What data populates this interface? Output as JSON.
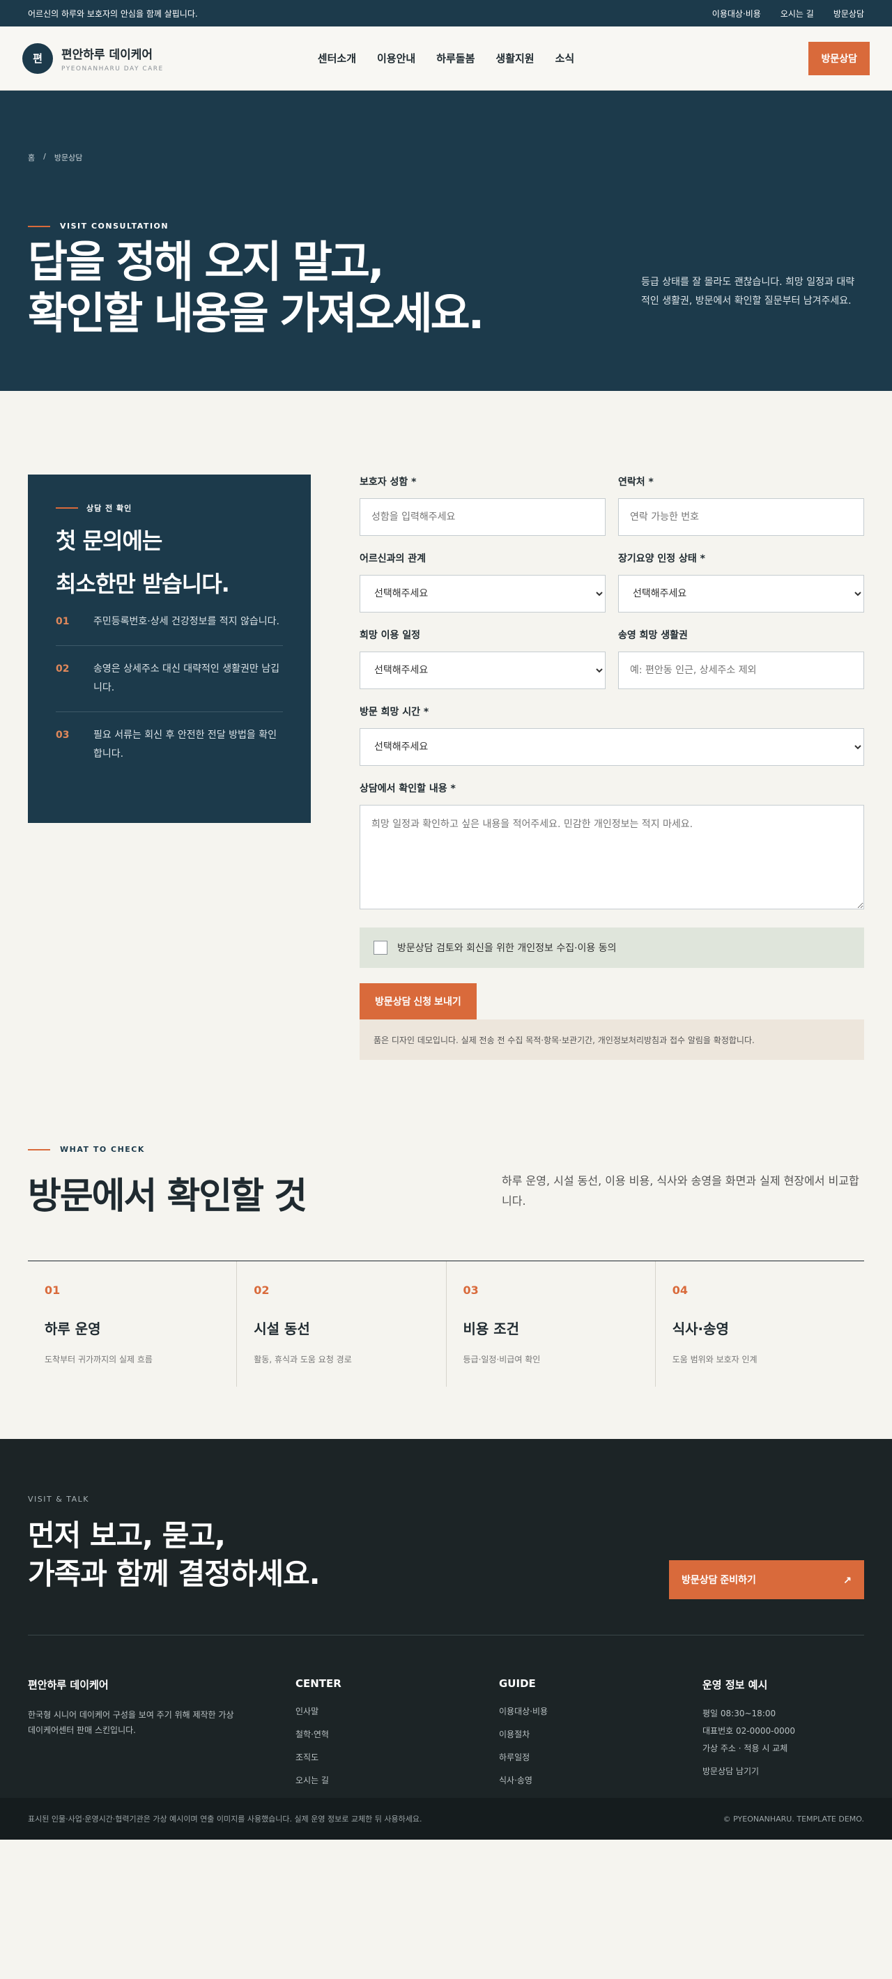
{
  "topbar": {
    "message": "어르신의 하루와 보호자의 안심을 함께 살핍니다.",
    "links": [
      "이용대상·비용",
      "오시는 길",
      "방문상담"
    ]
  },
  "header": {
    "logo_mark": "편",
    "name": "편안하루 데이케어",
    "sub": "PYEONANHARU DAY CARE",
    "nav": [
      "센터소개",
      "이용안내",
      "하루돌봄",
      "생활지원",
      "소식"
    ],
    "cta": "방문상담"
  },
  "hero": {
    "breadcrumb_home": "홈",
    "breadcrumb_sep": "/",
    "breadcrumb_current": "방문상담",
    "eyebrow": "VISIT CONSULTATION",
    "title_line1": "답을 정해 오지 말고,",
    "title_line2": "확인할 내용을 가져오세요.",
    "desc": "등급 상태를 잘 몰라도 괜찮습니다. 희망 일정과 대략적인 생활권, 방문에서 확인할 질문부터 남겨주세요."
  },
  "side": {
    "eyebrow": "상담 전 확인",
    "title_line1": "첫 문의에는",
    "title_line2": "최소한만 받습니다.",
    "items": [
      {
        "num": "01",
        "text": "주민등록번호·상세 건강정보를 적지 않습니다."
      },
      {
        "num": "02",
        "text": "송영은 상세주소 대신 대략적인 생활권만 남깁니다."
      },
      {
        "num": "03",
        "text": "필요 서류는 회신 후 안전한 전달 방법을 확인합니다."
      }
    ]
  },
  "form": {
    "guardian_label": "보호자 성함 *",
    "guardian_ph": "성함을 입력해주세요",
    "phone_label": "연락처 *",
    "phone_ph": "연락 가능한 번호",
    "relation_label": "어르신과의 관계",
    "relation_value": "선택해주세요",
    "grade_label": "장기요양 인정 상태 *",
    "grade_value": "선택해주세요",
    "schedule_label": "희망 이용 일정",
    "schedule_value": "선택해주세요",
    "area_label": "송영 희망 생활권",
    "area_ph": "예: 편안동 인근, 상세주소 제외",
    "time_label": "방문 희망 시간 *",
    "time_value": "선택해주세요",
    "content_label": "상담에서 확인할 내용 *",
    "content_ph": "희망 일정과 확인하고 싶은 내용을 적어주세요. 민감한 개인정보는 적지 마세요.",
    "consent": "방문상담 검토와 회신을 위한 개인정보 수집·이용 동의",
    "submit": "방문상담 신청 보내기",
    "notice": "품은 디자인 데모입니다. 실제 전송 전 수집 목적·항목·보관기간, 개인정보처리방침과 접수 알림을 확정합니다."
  },
  "check": {
    "eyebrow": "WHAT TO CHECK",
    "title": "방문에서 확인할 것",
    "desc": "하루 운영, 시설 동선, 이용 비용, 식사와 송영을 화면과 실제 현장에서 비교합니다.",
    "items": [
      {
        "num": "01",
        "title": "하루 운영",
        "desc": "도착부터 귀가까지의 실제 흐름"
      },
      {
        "num": "02",
        "title": "시설 동선",
        "desc": "활동, 휴식과 도움 요청 경로"
      },
      {
        "num": "03",
        "title": "비용 조건",
        "desc": "등급·일정·비급여 확인"
      },
      {
        "num": "04",
        "title": "식사·송영",
        "desc": "도움 범위와 보호자 인계"
      }
    ]
  },
  "footer": {
    "eyebrow": "VISIT & TALK",
    "title_line1": "먼저 보고, 묻고,",
    "title_line2": "가족과 함께 결정하세요.",
    "cta": "방문상담 준비하기",
    "cta_arrow": "↗",
    "brand": "편안하루 데이케어",
    "brand_desc": "한국형 시니어 데이케어 구성을 보여 주기 위해 제작한 가상 데이케어센터 판매 스킨입니다.",
    "col1_title": "CENTER",
    "col1": [
      "인사말",
      "철학·연혁",
      "조직도",
      "오시는 길"
    ],
    "col2_title": "GUIDE",
    "col2": [
      "이용대상·비용",
      "이용절차",
      "하루일정",
      "식사·송영"
    ],
    "col3_title": "운영 정보 예시",
    "col3": [
      "평일 08:30~18:00",
      "대표번호 02-0000-0000",
      "가상 주소 · 적용 시 교체",
      "방문상담 남기기"
    ],
    "bottom_left": "표시된 인물·사업·운영시간·협력기관은 가상 예시이며 연출 이미지를 사용했습니다. 실제 운영 정보로 교체한 뒤 사용하세요.",
    "bottom_right": "© PYEONANHARU. TEMPLATE DEMO."
  }
}
